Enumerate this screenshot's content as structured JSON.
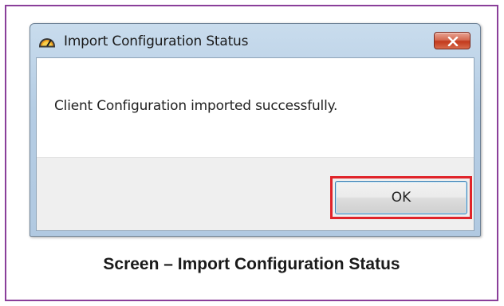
{
  "dialog": {
    "title": "Import Configuration Status",
    "message": "Client Configuration imported successfully.",
    "ok_label": "OK",
    "app_icon": "speedometer-icon",
    "close_icon": "close-icon"
  },
  "caption": "Screen – Import Configuration Status",
  "colors": {
    "frame_border": "#8a3f9a",
    "highlight": "#e0242a",
    "close_button": "#c2391c"
  }
}
